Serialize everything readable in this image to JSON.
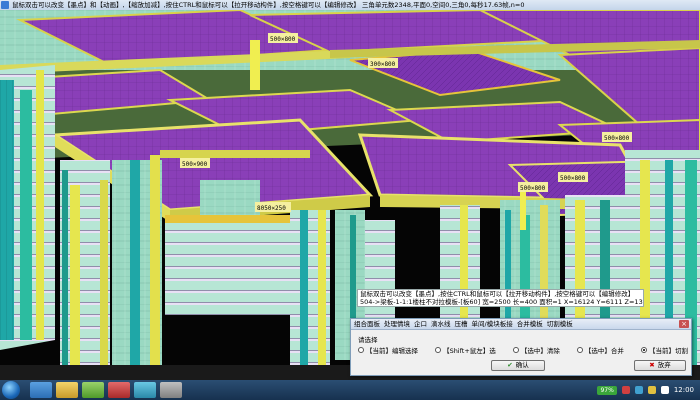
{
  "window": {
    "title": "鼠标双击可以改变【墨点】和【动画】,【缩放加减】,按住CTRL和鼠标可以【拉开移动构件】,按空格键可以【编辑修改】 三角单元数2348,平面0,空间0,三角0,每秒17.63帧,n=0"
  },
  "scene": {
    "labels": [
      "500×800",
      "300×800",
      "500×900",
      "8050×250",
      "500×800",
      "500×800",
      "500×800"
    ]
  },
  "command": {
    "lines": [
      "鼠标双击可以改变【墨点】,按住CTRL和鼠标可以【拉开移动构件】,按空格键可以【编辑修改】",
      "504->梁板-1-1:1楼柱不对拉模板-[板60] 宽=2500 长=400 面积=1 X=16124 Y=6111 Z=1300"
    ]
  },
  "dialog": {
    "tabs": [
      "组合面板",
      "处理情境",
      "企口",
      "滴水线",
      "压槽",
      "单间/模块板接",
      "合并模板",
      "切割模板"
    ],
    "prompt": "请选择",
    "options": [
      {
        "label": "【当前】编辑选择",
        "selected": false
      },
      {
        "label": "【Shift+鼠左】选",
        "selected": false
      },
      {
        "label": "【选中】清除",
        "selected": false
      },
      {
        "label": "【选中】合并",
        "selected": false
      },
      {
        "label": "【当前】切割",
        "selected": true
      }
    ],
    "ok_label": "确认",
    "cancel_label": "放弃"
  },
  "taskbar": {
    "cpu": "97%",
    "clock": "12:00"
  }
}
